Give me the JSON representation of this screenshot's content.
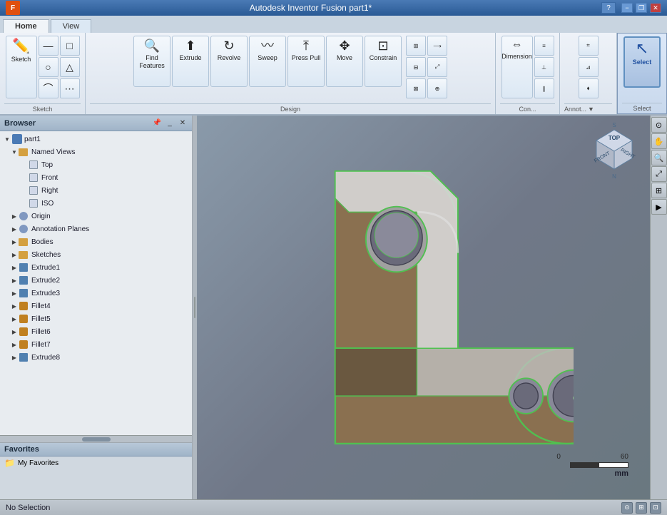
{
  "titlebar": {
    "title": "Autodesk Inventor Fusion  part1*",
    "help_label": "?",
    "min_label": "−",
    "restore_label": "❐",
    "close_label": "✕"
  },
  "tabs": {
    "items": [
      {
        "id": "home",
        "label": "Home",
        "active": true
      },
      {
        "id": "view",
        "label": "View",
        "active": false
      }
    ]
  },
  "ribbon": {
    "groups": [
      {
        "id": "sketch",
        "label": "Sketch",
        "buttons": []
      },
      {
        "id": "design",
        "label": "Design",
        "large_buttons": [
          {
            "id": "find-features",
            "label": "Find Features",
            "icon": "🔍"
          },
          {
            "id": "extrude",
            "label": "Extrude",
            "icon": "⬆"
          },
          {
            "id": "revolve",
            "label": "Revolve",
            "icon": "↻"
          },
          {
            "id": "sweep",
            "label": "Sweep",
            "icon": "〰"
          },
          {
            "id": "press-pull",
            "label": "Press Pull",
            "icon": "⤒"
          },
          {
            "id": "move",
            "label": "Move",
            "icon": "✥"
          },
          {
            "id": "constrain",
            "label": "Constrain",
            "icon": "⊡"
          }
        ]
      },
      {
        "id": "select",
        "label": "Select",
        "large_buttons": [
          {
            "id": "select",
            "label": "Select",
            "icon": "↖",
            "active": true
          }
        ]
      }
    ]
  },
  "browser": {
    "title": "Browser",
    "root": "part1",
    "items": [
      {
        "id": "part1",
        "label": "part1",
        "level": 0,
        "type": "part",
        "expanded": true
      },
      {
        "id": "named-views",
        "label": "Named Views",
        "level": 1,
        "type": "folder",
        "expanded": true
      },
      {
        "id": "top",
        "label": "Top",
        "level": 2,
        "type": "view"
      },
      {
        "id": "front",
        "label": "Front",
        "level": 2,
        "type": "view"
      },
      {
        "id": "right",
        "label": "Right",
        "level": 2,
        "type": "view"
      },
      {
        "id": "iso",
        "label": "ISO",
        "level": 2,
        "type": "view"
      },
      {
        "id": "origin",
        "label": "Origin",
        "level": 1,
        "type": "folder",
        "expanded": false
      },
      {
        "id": "annotation-planes",
        "label": "Annotation Planes",
        "level": 1,
        "type": "folder",
        "expanded": false
      },
      {
        "id": "bodies",
        "label": "Bodies",
        "level": 1,
        "type": "folder",
        "expanded": false
      },
      {
        "id": "sketches",
        "label": "Sketches",
        "level": 1,
        "type": "folder",
        "expanded": false
      },
      {
        "id": "extrude1",
        "label": "Extrude1",
        "level": 1,
        "type": "extrude"
      },
      {
        "id": "extrude2",
        "label": "Extrude2",
        "level": 1,
        "type": "extrude"
      },
      {
        "id": "extrude3",
        "label": "Extrude3",
        "level": 1,
        "type": "extrude"
      },
      {
        "id": "fillet4",
        "label": "Fillet4",
        "level": 1,
        "type": "fillet"
      },
      {
        "id": "fillet5",
        "label": "Fillet5",
        "level": 1,
        "type": "fillet"
      },
      {
        "id": "fillet6",
        "label": "Fillet6",
        "level": 1,
        "type": "fillet"
      },
      {
        "id": "fillet7",
        "label": "Fillet7",
        "level": 1,
        "type": "fillet"
      },
      {
        "id": "extrude8",
        "label": "Extrude8",
        "level": 1,
        "type": "extrude"
      }
    ]
  },
  "favorites": {
    "title": "Favorites",
    "items": [
      {
        "id": "my-favorites",
        "label": "My Favorites",
        "icon": "📁"
      }
    ]
  },
  "status": {
    "text": "No Selection"
  },
  "scale": {
    "label": "mm",
    "value0": "0",
    "value60": "60"
  },
  "viewcube": {
    "label": "TOP"
  }
}
